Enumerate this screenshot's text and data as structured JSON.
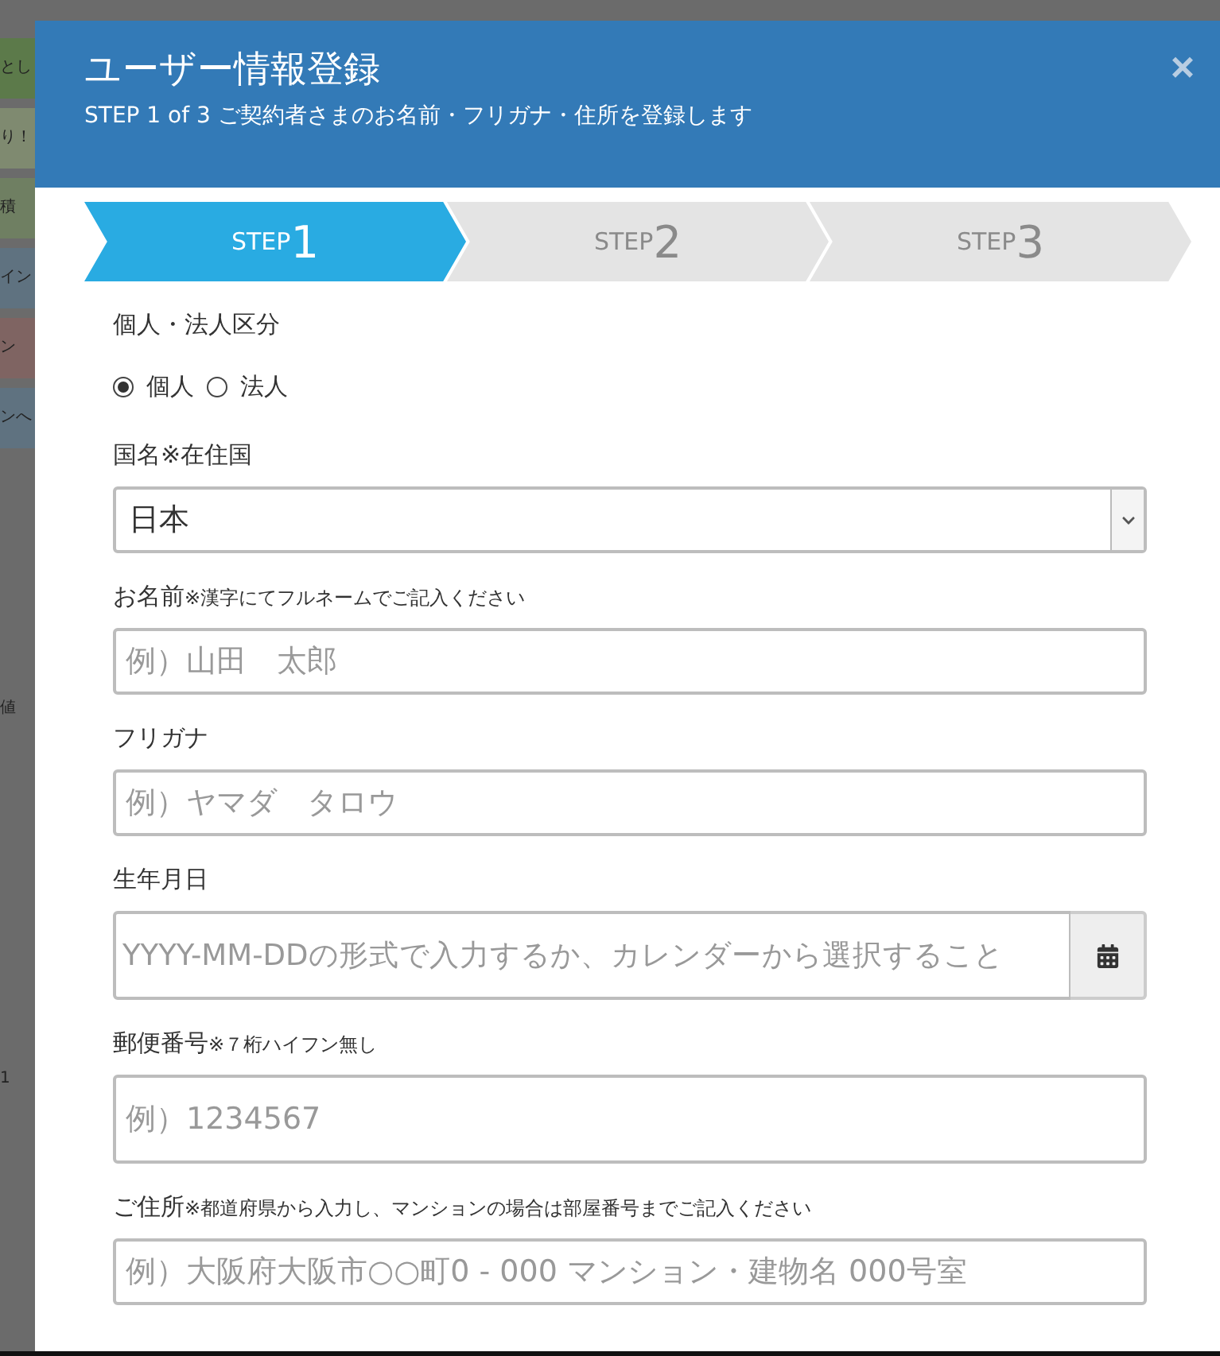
{
  "background_page": {
    "items": [
      {
        "text": "とし",
        "color": "#5c7a4a"
      },
      {
        "text": "り！",
        "color": "#7f8a70"
      },
      {
        "text": "積",
        "color": "#6f7f62"
      },
      {
        "text": "イン",
        "color": "#5f7280"
      },
      {
        "text": "ン",
        "color": "#7f6462"
      },
      {
        "text": "ンへ",
        "color": "#5f7280"
      }
    ],
    "lower_texts": [
      "値",
      "1"
    ]
  },
  "modal": {
    "title": "ユーザー情報登録",
    "subtitle": "STEP 1 of 3 ご契約者さまのお名前・フリガナ・住所を登録します",
    "close": "×"
  },
  "steps": [
    {
      "label": "STEP",
      "number": "1",
      "selected": true
    },
    {
      "label": "STEP",
      "number": "2",
      "selected": false
    },
    {
      "label": "STEP",
      "number": "3",
      "selected": false
    }
  ],
  "entity_type": {
    "label": "個人・法人区分",
    "options": [
      {
        "label": "個人",
        "selected": true
      },
      {
        "label": "法人",
        "selected": false
      }
    ]
  },
  "fields": [
    {
      "kind": "select",
      "label": "国名※在住国",
      "value": "日本"
    },
    {
      "kind": "text",
      "label": "お名前",
      "note": "※漢字にてフルネームでご記入ください",
      "placeholder": "例）山田　太郎"
    },
    {
      "kind": "text",
      "label": "フリガナ",
      "placeholder": "例）ヤマダ　タロウ"
    },
    {
      "kind": "date",
      "label": "生年月日",
      "placeholder": "YYYY-MM-DDの形式で入力するか、カレンダーから選択すること"
    },
    {
      "kind": "text",
      "label": "郵便番号",
      "note": "※７桁ハイフン無し",
      "placeholder": "例）1234567",
      "tall": true
    },
    {
      "kind": "text",
      "label": "ご住所",
      "note": "※都道府県から入力し、マンションの場合は部屋番号までご記入ください",
      "placeholder": "例）大阪府大阪市○○町0 - 000 マンション・建物名 000号室"
    }
  ]
}
